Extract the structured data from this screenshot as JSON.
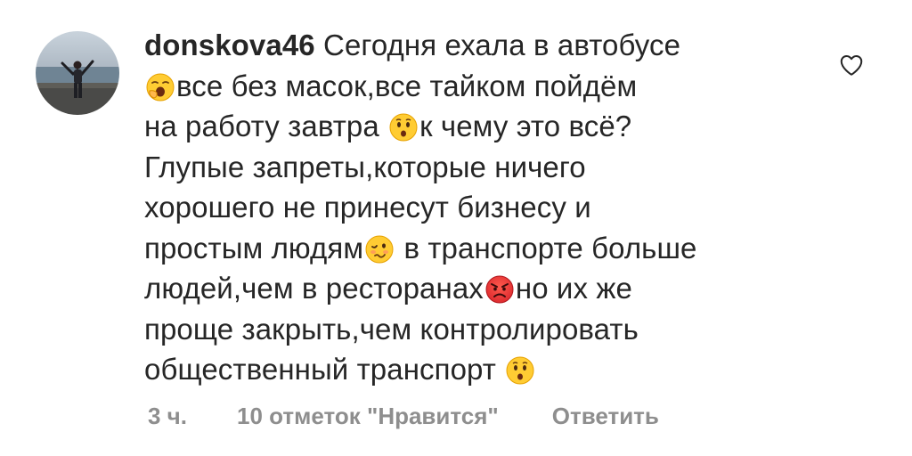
{
  "comment": {
    "username": "donskova46",
    "lines": [
      "Сегодня ехала в автобусе",
      "все без масок,все тайком пойдём",
      "на работу завтра ",
      "к чему это всё?",
      "Глупые запреты,которые ничего",
      "хорошего не принесут бизнесу и",
      "простым людям",
      " в транспорте больше",
      "людей,чем в ресторанах",
      "но их же",
      "проще закрыть,чем контролировать",
      "общественный транспорт "
    ],
    "emojis": {
      "line2": "yawning-face-emoji",
      "line3": "hushed-face-emoji",
      "line6": "woozy-face-emoji",
      "line7": "angry-face-emoji",
      "line9": "hushed-face-emoji"
    },
    "like_icon": "heart-outline-icon"
  },
  "meta": {
    "time": "3 ч.",
    "likes": "10 отметок \"Нравится\"",
    "reply": "Ответить"
  },
  "colors": {
    "text": "#262626",
    "secondary": "#8e8e8e",
    "emoji_yellow": "#ffcc33",
    "emoji_red": "#e8363a"
  }
}
